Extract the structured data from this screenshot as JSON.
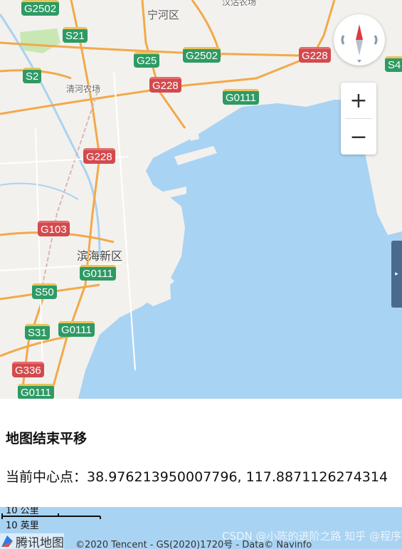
{
  "map": {
    "colors": {
      "land": "#f3f1ed",
      "sea": "#a9d3f3",
      "highway": "#f2a94a",
      "road": "#ffffff",
      "green": "#c9e7b3"
    },
    "places": {
      "ninghe": "宁河区",
      "hangu": "汉沽农场",
      "qinghe": "清河农场",
      "binhai": "滨海新区"
    },
    "shields": {
      "g2502_top": "G2502",
      "s21": "S21",
      "g25": "G25",
      "g2502": "G2502",
      "g228_right": "G228",
      "s2": "S2",
      "g228_mid": "G228",
      "g0111_top": "G0111",
      "s4": "S4",
      "g228_left": "G228",
      "g103": "G103",
      "g0111_mid": "G0111",
      "s50": "S50",
      "s31": "S31",
      "g0111_low": "G0111",
      "g336": "G336",
      "g0111_bottom": "G0111"
    },
    "controls": {
      "zoom_in": "+",
      "zoom_out": "−",
      "side_tab": "▸",
      "compass_icon": "compass-icon"
    }
  },
  "info": {
    "title": "地图结束平移",
    "center_label": "当前中心点：38.976213950007796, 117.8871126274314"
  },
  "footer": {
    "scale_metric": "10 公里",
    "scale_imperial": "10 英里",
    "logo_text": "腾讯地图",
    "copyright": "©2020 Tencent - GS(2020)1720号 - Data© Navinfo",
    "watermark": "CSDN @小陈的进阶之路  知乎 @程序员"
  }
}
